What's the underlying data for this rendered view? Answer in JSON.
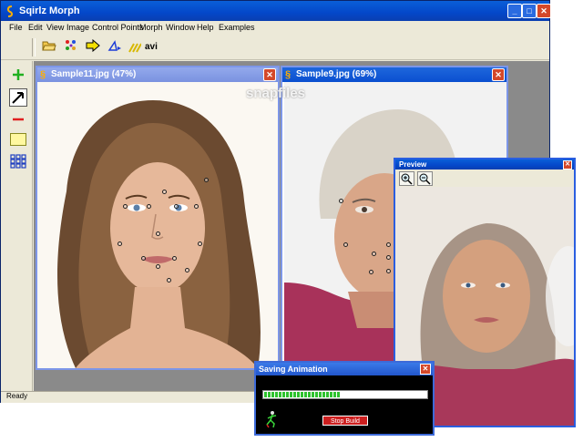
{
  "app": {
    "title": "Sqirlz Morph",
    "status": "Ready"
  },
  "menu": [
    "File",
    "Edit",
    "View",
    "Image",
    "Control Points",
    "Morph",
    "Window",
    "Help",
    "Examples"
  ],
  "toolbar": {
    "avi_label": "avi"
  },
  "windows": {
    "left": {
      "title": "Sample11.jpg  (47%)"
    },
    "right": {
      "title": "Sample9.jpg  (69%)"
    },
    "preview": {
      "title": "Preview"
    }
  },
  "watermark": "snapfiles",
  "saving": {
    "title": "Saving Animation",
    "progress": 0.47,
    "stop_label": "Stop Build"
  },
  "colors": {
    "title_blue": "#0a4fd0",
    "close_red": "#d4482a",
    "progress_green": "#2ec22e",
    "stop_red": "#cc1f1f"
  },
  "icons": [
    "app-icon",
    "open-folder-icon",
    "control-points-icon",
    "arrow-right-icon",
    "morph-icon",
    "avi-icon",
    "add-point-icon",
    "move-point-icon",
    "delete-point-icon",
    "select-rect-icon",
    "grid-icon",
    "zoom-in-icon",
    "zoom-out-icon",
    "running-figure-icon"
  ]
}
